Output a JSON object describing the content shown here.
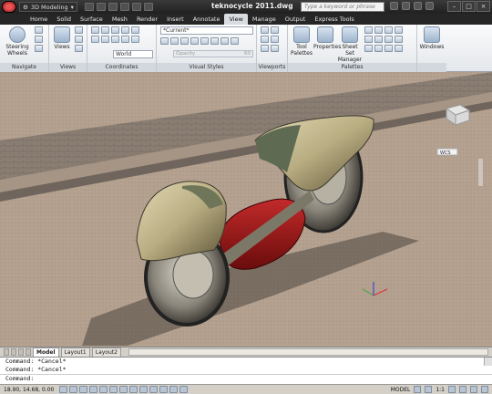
{
  "window": {
    "workspace": "3D Modeling",
    "title": "teknocycle 2011.dwg",
    "search_placeholder": "Type a keyword or phrase",
    "controls": [
      "–",
      "□",
      "×"
    ]
  },
  "ribbon": {
    "tabs": [
      "Home",
      "Solid",
      "Surface",
      "Mesh",
      "Render",
      "Insert",
      "Annotate",
      "View",
      "Manage",
      "Output",
      "Express Tools"
    ],
    "active_tab": "View",
    "panels": {
      "navigate": {
        "label": "Navigate",
        "steering": "Steering Wheels"
      },
      "views": {
        "label": "Views",
        "views_btn": "Views"
      },
      "coordinates": {
        "label": "Coordinates",
        "ucs": "World"
      },
      "visual_styles": {
        "label": "Visual Styles",
        "current": "*Current*",
        "opacity_label": "Opacity",
        "opacity_value": "60"
      },
      "viewports": {
        "label": "Viewports"
      },
      "palettes": {
        "label": "Palettes",
        "tool_palettes": "Tool Palettes",
        "properties": "Properties",
        "sheet_set": "Sheet Set Manager"
      },
      "window": {
        "windows": "Windows"
      }
    }
  },
  "viewcube": {
    "wcs": "WCS"
  },
  "layout_tabs": [
    "Model",
    "Layout1",
    "Layout2"
  ],
  "active_layout": "Model",
  "command_line": {
    "history": [
      "Command: *Cancel*",
      "Command: *Cancel*"
    ],
    "prompt": "Command:"
  },
  "status_bar": {
    "coords": "18.90,  14.68,  0.00",
    "model": "MODEL",
    "scale": "1:1"
  },
  "colors": {
    "body_red": "#a01818",
    "fender_tan": "#b9ad82",
    "ground": "#b3a08f",
    "road": "#8a7e73"
  }
}
